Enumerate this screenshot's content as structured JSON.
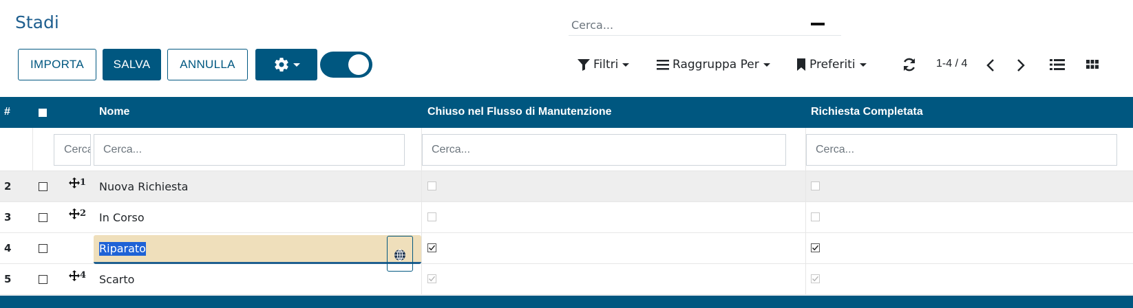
{
  "page": {
    "title": "Stadi"
  },
  "search": {
    "placeholder": "Cerca..."
  },
  "toolbar": {
    "import_label": "IMPORTA",
    "save_label": "SALVA",
    "cancel_label": "ANNULLA",
    "gear_icon": "gear-icon",
    "toggle_on": true
  },
  "control_panel": {
    "filters_label": "Filtri",
    "groupby_label": "Raggruppa Per",
    "favorites_label": "Preferiti",
    "pager": "1-4 / 4"
  },
  "table": {
    "columns": {
      "index": "#",
      "name": "Nome",
      "closed": "Chiuso nel Flusso di Manutenzione",
      "done": "Richiesta Completata"
    },
    "filter_placeholders": {
      "sequence": "Cerca...",
      "name": "Cerca...",
      "closed": "Cerca...",
      "done": "Cerca..."
    },
    "rows": [
      {
        "num": "2",
        "seq": "1",
        "name": "Nuova Richiesta",
        "closed": false,
        "done": false
      },
      {
        "num": "3",
        "seq": "2",
        "name": "In Corso",
        "closed": false,
        "done": false
      },
      {
        "num": "4",
        "seq": "",
        "name": "Riparato",
        "closed": true,
        "done": true,
        "editing": true
      },
      {
        "num": "5",
        "seq": "4",
        "name": "Scarto",
        "closed": true,
        "done": true
      }
    ]
  },
  "colors": {
    "primary": "#005780",
    "edit_bg": "#efdfbb",
    "selection": "#1e62d6"
  }
}
